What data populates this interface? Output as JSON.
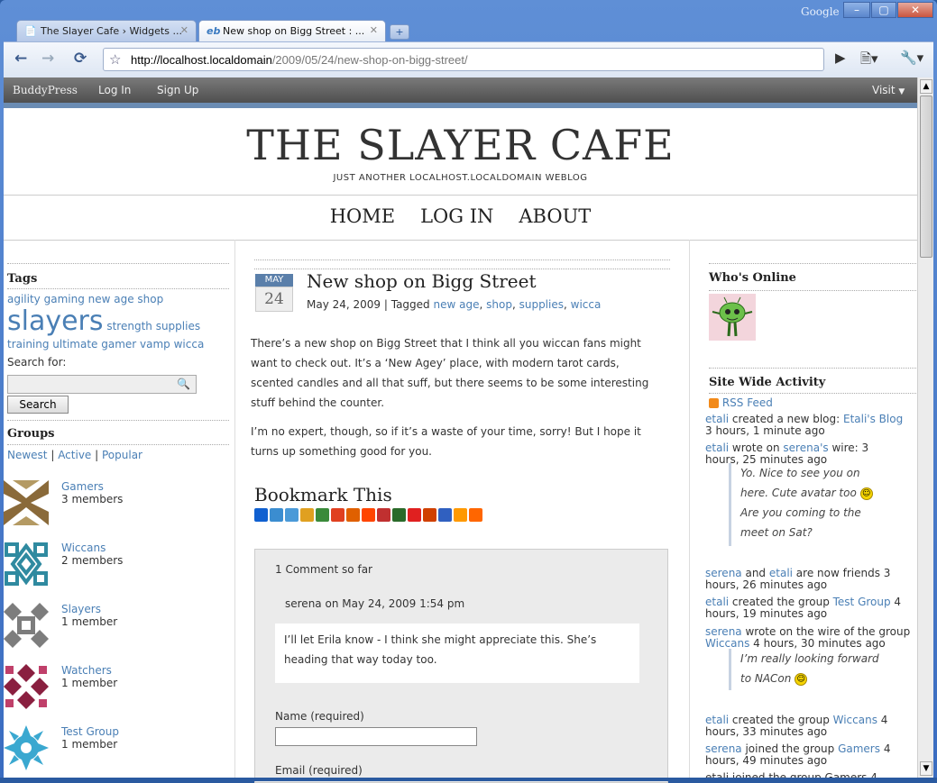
{
  "browser": {
    "tabs": [
      {
        "label": "The Slayer Cafe › Widgets ..."
      },
      {
        "label": "New shop on Bigg Street : ..."
      }
    ],
    "google_label": "Google",
    "url_host": "http://localhost.localdomain",
    "url_path": "/2009/05/24/new-shop-on-bigg-street/"
  },
  "bpbar": {
    "brand": "BuddyPress",
    "login": "Log In",
    "signup": "Sign Up",
    "visit": "Visit"
  },
  "site": {
    "title": "THE SLAYER CAFE",
    "tagline": "JUST ANOTHER LOCALHOST.LOCALDOMAIN WEBLOG",
    "nav": [
      "HOME",
      "LOG IN",
      "ABOUT"
    ]
  },
  "sidebar": {
    "tags_title": "Tags",
    "tags_line1": "agility gaming new age shop",
    "tags_big": "slayers",
    "tags_rest1": " strength supplies",
    "tags_line3": "training ultimate gamer vamp wicca",
    "search_label": "Search for:",
    "search_value": "",
    "search_button": "Search",
    "groups_title": "Groups",
    "groups_filters": [
      "Newest",
      "Active",
      "Popular"
    ],
    "groups": [
      {
        "name": "Gamers",
        "members": "3 members",
        "color": "#8a6a3a"
      },
      {
        "name": "Wiccans",
        "members": "2 members",
        "color": "#2f8aa0"
      },
      {
        "name": "Slayers",
        "members": "1 member",
        "color": "#7d7d7d"
      },
      {
        "name": "Watchers",
        "members": "1 member",
        "color": "#8a2040"
      },
      {
        "name": "Test Group",
        "members": "1 member",
        "color": "#3aa8d0"
      }
    ]
  },
  "post": {
    "month": "MAY",
    "day": "24",
    "title": "New shop on Bigg Street",
    "date": "May 24, 2009",
    "tagged_label": "Tagged",
    "tags": [
      "new age",
      "shop",
      "supplies",
      "wicca"
    ],
    "para1": "There’s a new shop on Bigg Street that I think all you wiccan fans might want to check out.  It’s a ‘New Agey’ place, with modern tarot cards, scented candles and all that suff, but there seems to be some interesting stuff behind the counter.",
    "para2": "I’m no expert, though, so if it’s a waste of your time, sorry!  But I hope it turns up something good for you.",
    "bookmark_title": "Bookmark This",
    "bookmark_colors": [
      "#1060d0",
      "#3b8dd0",
      "#4a9ad8",
      "#e0a020",
      "#3a8a3a",
      "#e04020",
      "#e06000",
      "#ff4500",
      "#c03030",
      "#2a6a2a",
      "#e02020",
      "#d04000",
      "#3060c0",
      "#ff9900",
      "#ff6600"
    ]
  },
  "comments": {
    "count_label": "1 Comment so far",
    "author": "serena",
    "when": "on May 24, 2009 1:54 pm",
    "text": "I’ll let Erila know - I think she might appreciate this. She’s heading that way today too.",
    "name_label": "Name (required)",
    "email_label": "Email (required)"
  },
  "right": {
    "online_title": "Who's Online",
    "activity_title": "Site Wide Activity",
    "rss": "RSS Feed",
    "a1_user": "etali",
    "a1_text": " created a new blog: ",
    "a1_link": "Etali's Blog",
    "a1_time": "3 hours, 1 minute ago",
    "a2_user": "etali",
    "a2_mid": " wrote on ",
    "a2_link": "serena's",
    "a2_tail": " wire:   3",
    "a2_time": "hours, 25 minutes ago",
    "q1_l1": "Yo. Nice to see you on",
    "q1_l2": "here. Cute avatar too",
    "q1_l3": "Are you coming to the",
    "q1_l4": "meet on Sat?",
    "a3_user": "serena",
    "a3_mid": " and ",
    "a3_link": "etali",
    "a3_tail": " are now friends   3",
    "a3_time": "hours, 26 minutes ago",
    "a4_user": "etali",
    "a4_mid": " created the group ",
    "a4_link": "Test Group",
    "a4_tail": "   4",
    "a4_time": "hours, 19 minutes ago",
    "a5_user": "serena",
    "a5_mid": " wrote on the wire of the group",
    "a5_link": "Wiccans",
    "a5_tail": "   4 hours, 30 minutes ago",
    "q2_l1": "I’m really looking forward",
    "q2_l2": "to NACon",
    "a6_user": "etali",
    "a6_mid": " created the group ",
    "a6_link": "Wiccans",
    "a6_tail": "   4",
    "a6_time": "hours, 33 minutes ago",
    "a7_user": "serena",
    "a7_mid": " joined the group ",
    "a7_link": "Gamers",
    "a7_tail": "   4",
    "a7_time": "hours, 49 minutes ago",
    "a8_partial": "etali joined the group Gamers   4"
  }
}
